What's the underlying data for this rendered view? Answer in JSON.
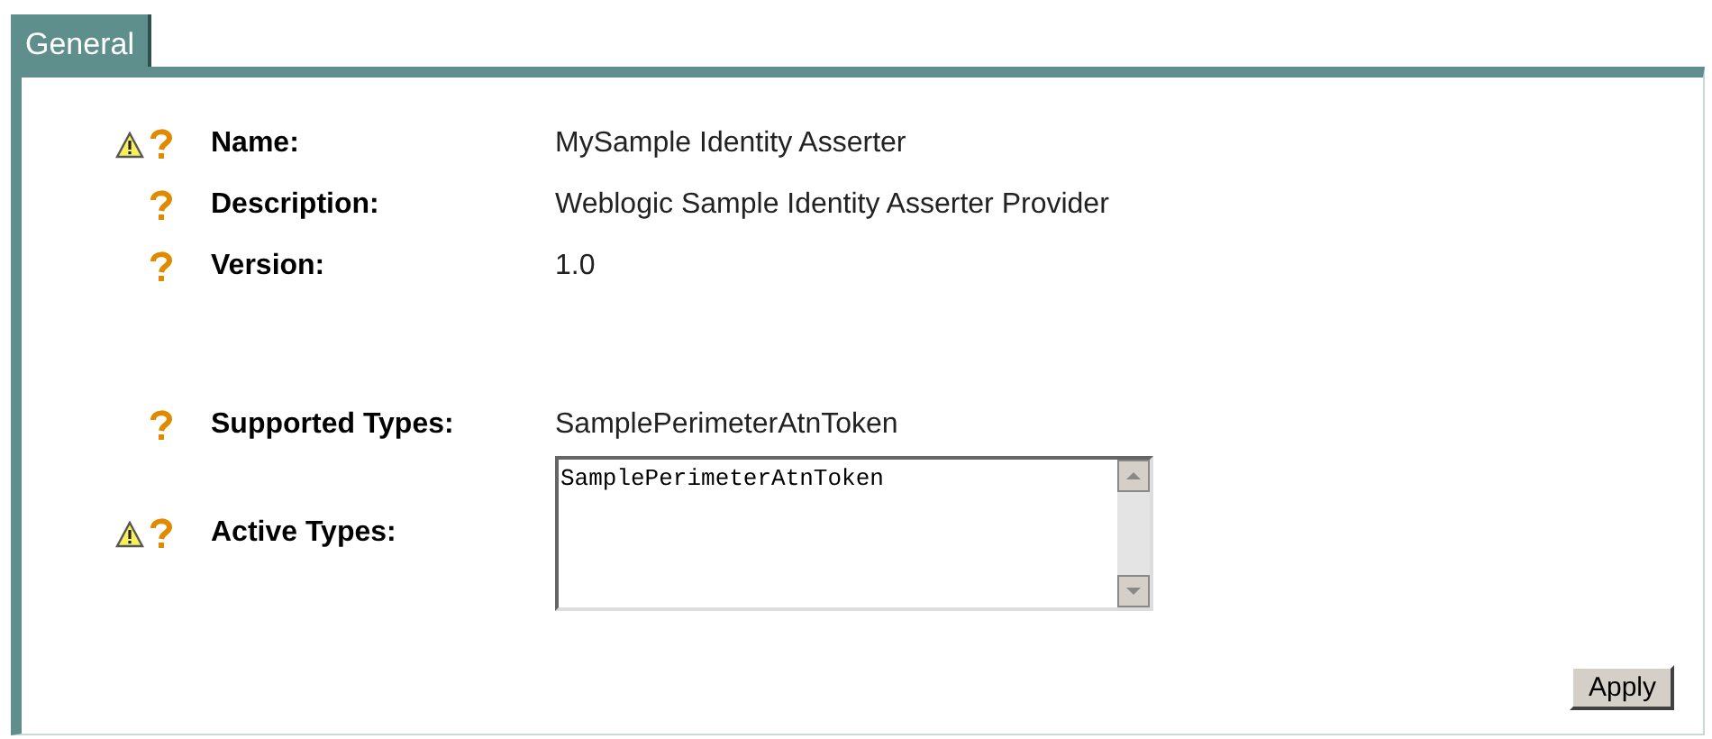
{
  "tabs": [
    {
      "label": "General",
      "selected": true
    }
  ],
  "fields": [
    {
      "kind": "text",
      "label": "Name:",
      "warning": true,
      "value": "MySample Identity Asserter"
    },
    {
      "kind": "text",
      "label": "Description:",
      "warning": false,
      "value": "Weblogic Sample Identity Asserter Provider"
    },
    {
      "kind": "text",
      "label": "Version:",
      "warning": false,
      "value": "1.0"
    },
    {
      "kind": "spacer"
    },
    {
      "kind": "text",
      "label": "Supported Types:",
      "warning": false,
      "value": "SamplePerimeterAtnToken"
    },
    {
      "kind": "list",
      "label": "Active Types:",
      "warning": true,
      "items": [
        "SamplePerimeterAtnToken"
      ]
    }
  ],
  "buttons": [
    "Apply"
  ]
}
